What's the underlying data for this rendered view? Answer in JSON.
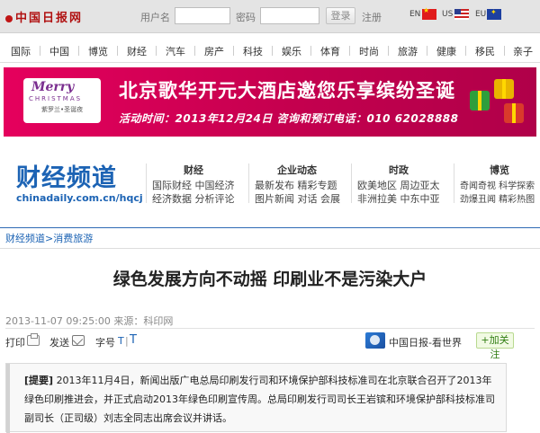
{
  "header": {
    "logo": "中国日报网",
    "username_label": "用户名",
    "password_label": "密码",
    "login_button": "登录",
    "register_link": "注册",
    "langs": [
      "EN",
      "US",
      "EU"
    ]
  },
  "nav": {
    "items": [
      "国际",
      "中国",
      "博览",
      "财经",
      "汽车",
      "房产",
      "科技",
      "娱乐",
      "体育",
      "时尚",
      "旅游",
      "健康",
      "移民",
      "亲子"
    ]
  },
  "banner": {
    "logo_merry": "Merry",
    "logo_christmas": "CHRISTMAS",
    "logo_brand": "紫罗兰•圣诞夜",
    "headline": "北京歌华开元大酒店邀您乐享缤纷圣诞",
    "sub": "活动时间：2013年12月24日  咨询和预订电话：010 62028888"
  },
  "channel": {
    "title": "财经频道",
    "url": "chinadaily.com.cn/hqcj",
    "columns": [
      {
        "head": "财经",
        "row1": "国际财经  中国经济",
        "row2": "经济数据  分析评论"
      },
      {
        "head": "企业动态",
        "row1": "最新发布  精彩专题",
        "row2": "图片新闻  对话  会展"
      },
      {
        "head": "时政",
        "row1": "欧美地区  周边亚太",
        "row2": "非洲拉美  中东中亚"
      },
      {
        "head": "博览",
        "row1": "奇闻奇视  科学探索",
        "row2": "劲爆丑闻  精彩热图"
      }
    ]
  },
  "breadcrumb": {
    "section": "财经频道",
    "sep": ">",
    "sub": "消费旅游"
  },
  "article": {
    "title": "绿色发展方向不动摇 印刷业不是污染大户",
    "meta": "2013-11-07 09:25:00 来源：科印网",
    "tools": {
      "print": "打印",
      "send": "发送",
      "font_size": "字号",
      "font_small": "T",
      "font_sep": "|",
      "font_big": "T"
    },
    "follow_text": "中国日报-看世界",
    "follow_button": "+加关注",
    "summary_tag": "[提要]",
    "summary": "2013年11月4日，新闻出版广电总局印刷发行司和环境保护部科技标准司在北京联合召开了2013年绿色印刷推进会，并正式启动2013年绿色印刷宣传周。总局印刷发行司司长王岩镔和环境保护部科技标准司副司长（正司级）刘志全同志出席会议并讲话。"
  },
  "colors": {
    "brand_blue": "#1c63b4",
    "banner_magenta": "#e5005d",
    "logo_red": "#b01010"
  }
}
